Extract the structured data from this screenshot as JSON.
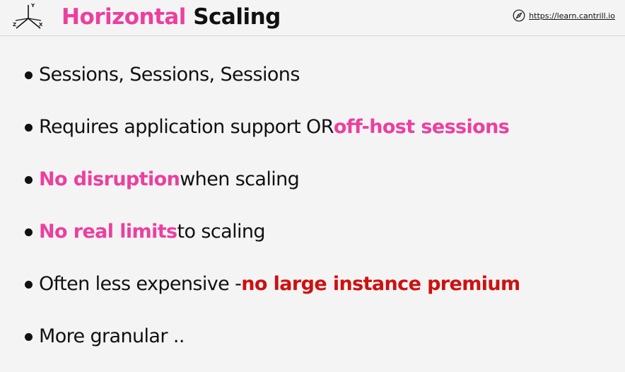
{
  "header": {
    "axis_labels": {
      "y": "Y",
      "z": "Z",
      "x": "X"
    },
    "title_accent": "Horizontal",
    "title_rest": " Scaling",
    "site_url": "https://learn.cantrill.io"
  },
  "bullets": [
    {
      "text": "Sessions, Sessions, Sessions"
    },
    {
      "pre": "Requires application support OR ",
      "highlight": "off-host sessions"
    },
    {
      "highlight": "No disruption",
      "post": " when scaling"
    },
    {
      "highlight": "No real limits",
      "post": " to scaling"
    },
    {
      "pre": "Often less expensive - ",
      "highlight": "no large instance premium"
    },
    {
      "text": "More granular .."
    }
  ],
  "colors": {
    "accent_pink": "#ec3f9e",
    "accent_red": "#cc1111",
    "background": "#f4f4f4",
    "text": "#111111"
  },
  "icons": {
    "logo": "xyz-axis-icon",
    "link": "compass-icon",
    "bullet": "bullet-dot"
  }
}
